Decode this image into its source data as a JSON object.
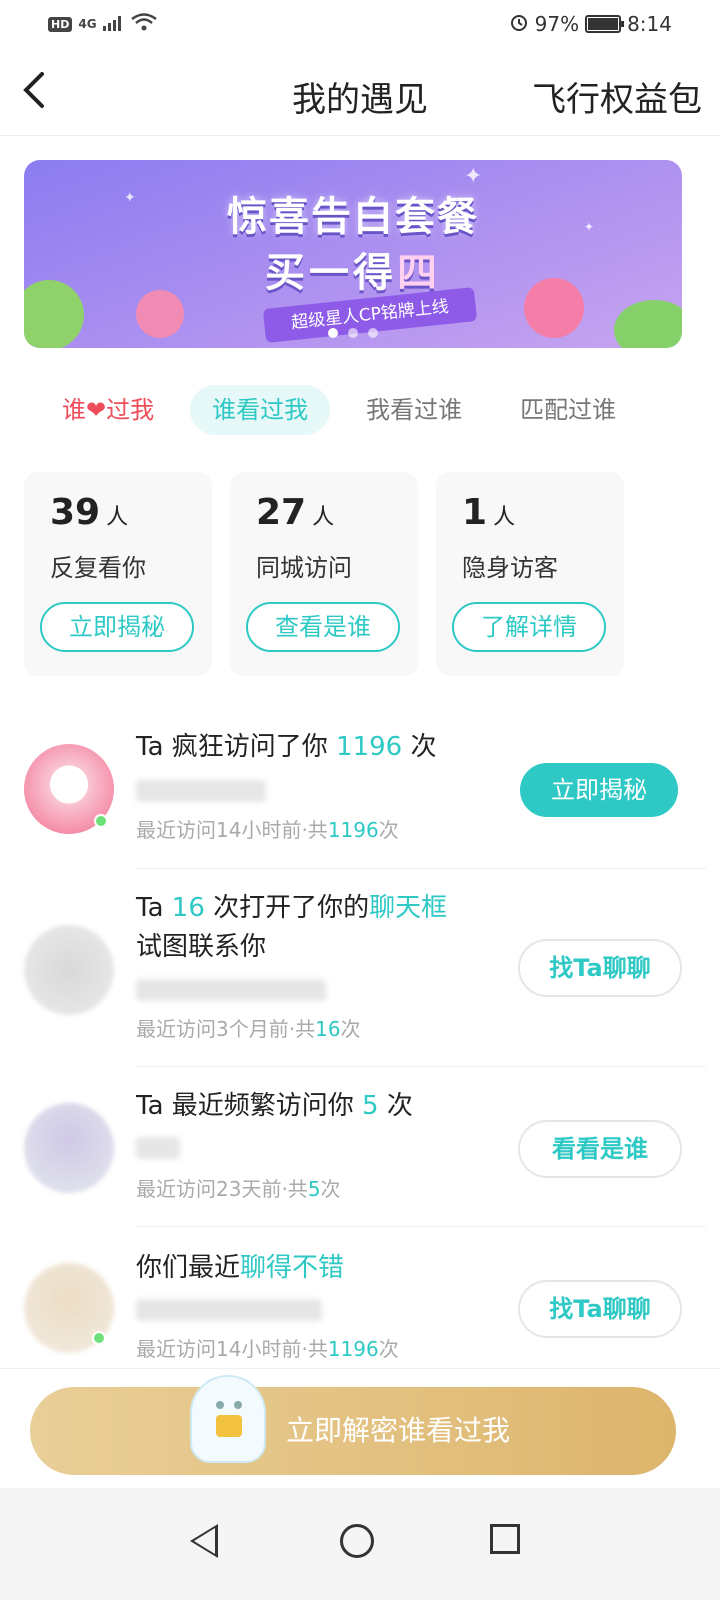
{
  "status": {
    "battery": "97%",
    "time": "8:14",
    "network": "4G",
    "hd": "HD"
  },
  "header": {
    "back": "<",
    "title": "我的遇见",
    "right_link": "飞行权益包"
  },
  "banner": {
    "line1": "惊喜告白套餐",
    "line2_a": "买一得",
    "line2_b": "四",
    "ribbon": "超级星人CP铭牌上线"
  },
  "tabs": [
    {
      "label_a": "谁",
      "label_b": "过我"
    },
    {
      "label": "谁看过我"
    },
    {
      "label": "我看过谁"
    },
    {
      "label": "匹配过谁"
    }
  ],
  "cards": [
    {
      "num": "39",
      "unit": "人",
      "label": "反复看你",
      "button": "立即揭秘"
    },
    {
      "num": "27",
      "unit": "人",
      "label": "同城访问",
      "button": "查看是谁"
    },
    {
      "num": "1",
      "unit": "人",
      "label": "隐身访客",
      "button": "了解详情"
    }
  ],
  "visitors": [
    {
      "a": "Ta 疯狂访问了你 ",
      "h": "1196",
      "b": " 次",
      "sub_a": "最近访问14小时前·共",
      "sub_h": "1196",
      "sub_b": "次",
      "button": "立即揭秘"
    },
    {
      "a": "Ta ",
      "h": "16",
      "b": " 次打开了你的",
      "h2": "聊天框",
      "l2": "试图联系你",
      "sub_a": "最近访问3个月前·共",
      "sub_h": "16",
      "sub_b": "次",
      "button": "找Ta聊聊"
    },
    {
      "a": "Ta 最近频繁访问你 ",
      "h": "5",
      "b": " 次",
      "sub_a": "最近访问23天前·共",
      "sub_h": "5",
      "sub_b": "次",
      "button": "看看是谁"
    },
    {
      "a": "你们最近",
      "h": "聊得不错",
      "sub_a": "最近访问14小时前·共",
      "sub_h": "1196",
      "sub_b": "次",
      "button": "找Ta聊聊"
    }
  ],
  "cta": {
    "label": "立即解密谁看过我"
  },
  "colors": {
    "accent": "#2ec9c5",
    "red": "#ef4d5a",
    "gold": "#ddb56c"
  }
}
